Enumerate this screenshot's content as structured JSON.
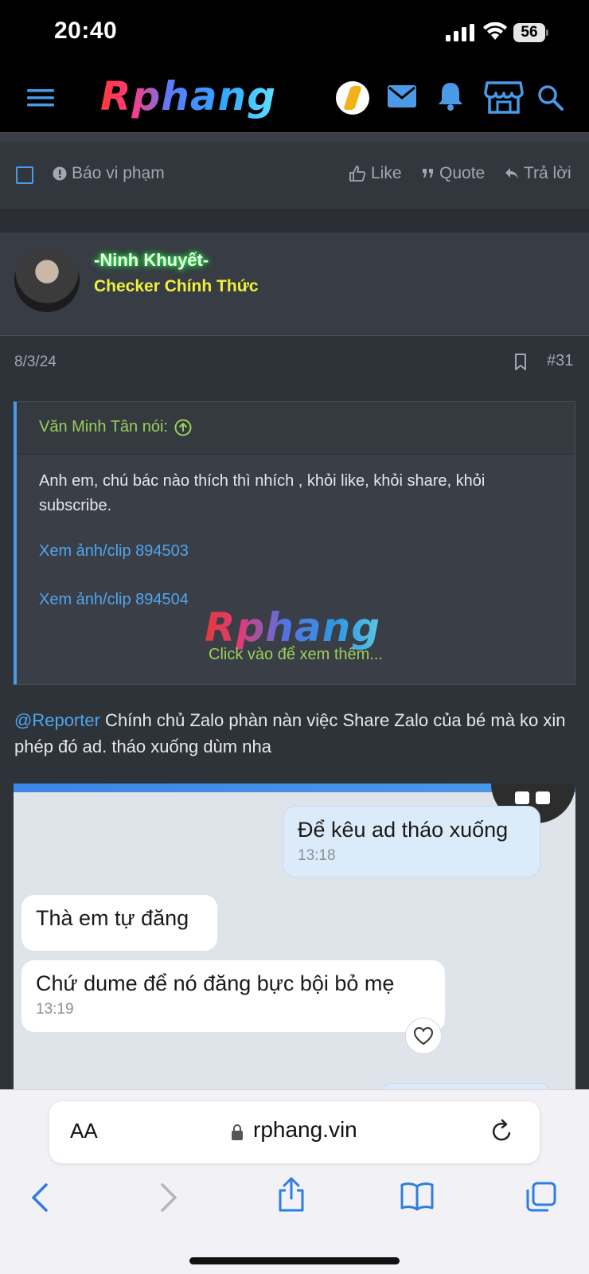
{
  "status_bar": {
    "time": "20:40",
    "battery": "56"
  },
  "header": {
    "logo": "Rphang"
  },
  "action_bar": {
    "report": "Báo vi phạm",
    "like": "Like",
    "quote": "Quote",
    "reply": "Trả lời"
  },
  "author": {
    "name": "-Ninh Khuyết-",
    "title": "Checker Chính Thức"
  },
  "post": {
    "date": "8/3/24",
    "number": "#31",
    "quote": {
      "author": "Văn Minh Tân nói:",
      "text": "Anh em, chú bác nào thích thì nhích , khỏi like, khỏi share, khỏi subscribe.",
      "links": [
        "Xem ảnh/clip 894503",
        "Xem ảnh/clip 894504"
      ],
      "watermark": "Rphang",
      "more": "Click vào để xem thêm..."
    },
    "comment": {
      "mention": "@Reporter",
      "text": " Chính chủ Zalo phàn nàn việc Share Zalo của bé mà ko xin phép đó ad. tháo xuống dùm nha"
    },
    "chat": {
      "messages": [
        {
          "text": "Để kêu ad tháo xuống",
          "time": "13:18"
        },
        {
          "text": "Thà em tự đăng"
        },
        {
          "text": "Chứ dume để nó đăng bực bội bỏ mẹ",
          "time": "13:19"
        }
      ]
    }
  },
  "browser": {
    "aa": "AA",
    "url": "rphang.vin"
  },
  "colors": {
    "accent": "#4a9ae8",
    "quote_author": "#9bd05a",
    "checker_title": "#f0f03a",
    "name_glow": "#2dff45"
  }
}
